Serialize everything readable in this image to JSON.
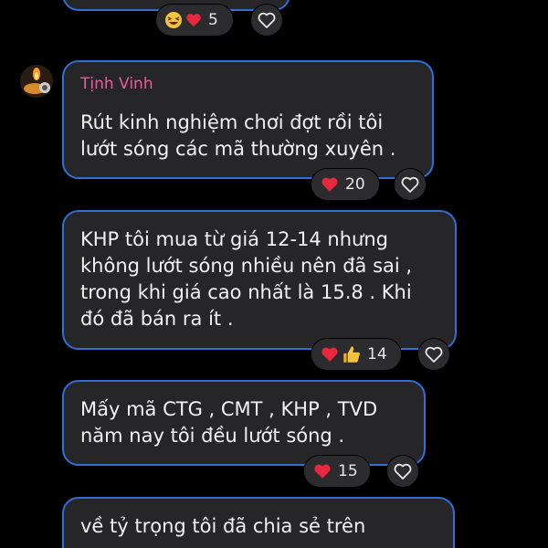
{
  "messages": [
    {
      "id": "top-partial",
      "reactions": [
        {
          "icon": "laughing-emoji-icon"
        },
        {
          "icon": "red-heart-icon"
        }
      ],
      "reaction_count": "5"
    },
    {
      "id": "msg-1",
      "sender": "Tịnh Vinh",
      "text": "Rút kinh nghiệm chơi đợt rồi tôi\nlướt sóng các mã thường xuyên .",
      "reactions": [
        {
          "icon": "red-heart-icon"
        }
      ],
      "reaction_count": "20"
    },
    {
      "id": "msg-2",
      "text": "KHP tôi mua từ giá 12-14 nhưng\nkhông lướt sóng nhiều nên đã sai ,\ntrong khi giá cao nhất là 15.8 . Khi\nđó đã bán ra ít .",
      "reactions": [
        {
          "icon": "red-heart-icon"
        },
        {
          "icon": "thumbs-up-icon"
        }
      ],
      "reaction_count": "14"
    },
    {
      "id": "msg-3",
      "text": "Mấy mã CTG , CMT , KHP , TVD\nnăm nay tôi đều lướt sóng .",
      "reactions": [
        {
          "icon": "red-heart-icon"
        }
      ],
      "reaction_count": "15"
    },
    {
      "id": "msg-4",
      "text": "về tỷ trọng tôi đã chia sẻ trên"
    }
  ],
  "colors": {
    "background": "#000000",
    "bubble": "#262628",
    "bubble_border": "#2f6fd6",
    "sender_name": "#ea5c9a",
    "heart": "#e8283c"
  }
}
